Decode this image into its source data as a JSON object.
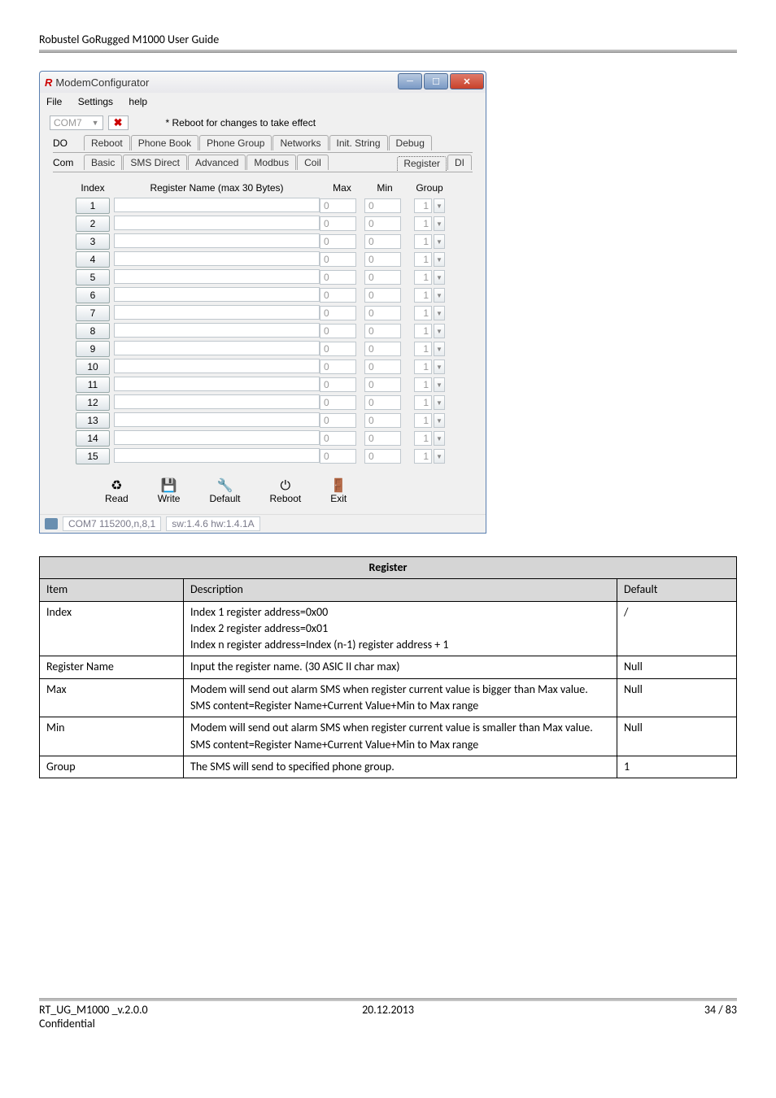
{
  "doc_header": "Robustel GoRugged M1000 User Guide",
  "window": {
    "title": "ModemConfigurator",
    "menus": [
      "File",
      "Settings",
      "help"
    ],
    "com_port": "COM7",
    "reboot_hint": "* Reboot for changes to take effect",
    "row1_label": "DO",
    "row2_label": "Com",
    "tabs_row1": [
      "Reboot",
      "Phone Book",
      "Phone Group",
      "Networks",
      "Init. String",
      "Debug"
    ],
    "tabs_row2": [
      "Basic",
      "SMS Direct",
      "Advanced",
      "Modbus",
      "Coil"
    ],
    "tabs_row2_right": [
      "Register",
      "DI"
    ],
    "headers": {
      "index": "Index",
      "name": "Register Name (max 30 Bytes)",
      "max": "Max",
      "min": "Min",
      "group": "Group"
    },
    "rows": [
      {
        "index": "1",
        "name": "",
        "max": "0",
        "min": "0",
        "group": "1"
      },
      {
        "index": "2",
        "name": "",
        "max": "0",
        "min": "0",
        "group": "1"
      },
      {
        "index": "3",
        "name": "",
        "max": "0",
        "min": "0",
        "group": "1"
      },
      {
        "index": "4",
        "name": "",
        "max": "0",
        "min": "0",
        "group": "1"
      },
      {
        "index": "5",
        "name": "",
        "max": "0",
        "min": "0",
        "group": "1"
      },
      {
        "index": "6",
        "name": "",
        "max": "0",
        "min": "0",
        "group": "1"
      },
      {
        "index": "7",
        "name": "",
        "max": "0",
        "min": "0",
        "group": "1"
      },
      {
        "index": "8",
        "name": "",
        "max": "0",
        "min": "0",
        "group": "1"
      },
      {
        "index": "9",
        "name": "",
        "max": "0",
        "min": "0",
        "group": "1"
      },
      {
        "index": "10",
        "name": "",
        "max": "0",
        "min": "0",
        "group": "1"
      },
      {
        "index": "11",
        "name": "",
        "max": "0",
        "min": "0",
        "group": "1"
      },
      {
        "index": "12",
        "name": "",
        "max": "0",
        "min": "0",
        "group": "1"
      },
      {
        "index": "13",
        "name": "",
        "max": "0",
        "min": "0",
        "group": "1"
      },
      {
        "index": "14",
        "name": "",
        "max": "0",
        "min": "0",
        "group": "1"
      },
      {
        "index": "15",
        "name": "",
        "max": "0",
        "min": "0",
        "group": "1"
      }
    ],
    "actions": {
      "read": "Read",
      "write": "Write",
      "default": "Default",
      "reboot": "Reboot",
      "exit": "Exit"
    },
    "status_port": "COM7 115200,n,8,1",
    "status_sw": "sw:1.4.6 hw:1.4.1A"
  },
  "desc": {
    "title": "Register",
    "header": {
      "item": "Item",
      "desc": "Description",
      "def": "Default"
    },
    "rows": [
      {
        "item": "Index",
        "desc": "Index 1 register address=0x00\nIndex 2 register address=0x01\nIndex n register address=Index (n-1) register address + 1",
        "def": "/"
      },
      {
        "item": "Register Name",
        "desc": "Input the register name. (30 ASIC II char max)",
        "def": "Null"
      },
      {
        "item": "Max",
        "desc": "Modem will send out alarm SMS when register current value is bigger than Max value.\nSMS content=Register Name+Current Value+Min to Max range",
        "def": "Null"
      },
      {
        "item": "Min",
        "desc": "Modem will send out alarm SMS when register current value is smaller than Max value.\nSMS content=Register Name+Current Value+Min to Max range",
        "def": "Null"
      },
      {
        "item": "Group",
        "desc": "The SMS will send to specified phone group.",
        "def": "1"
      }
    ]
  },
  "footer": {
    "left": "RT_UG_M1000 _v.2.0.0",
    "left2": "Confidential",
    "center": "20.12.2013",
    "right": "34 / 83"
  }
}
